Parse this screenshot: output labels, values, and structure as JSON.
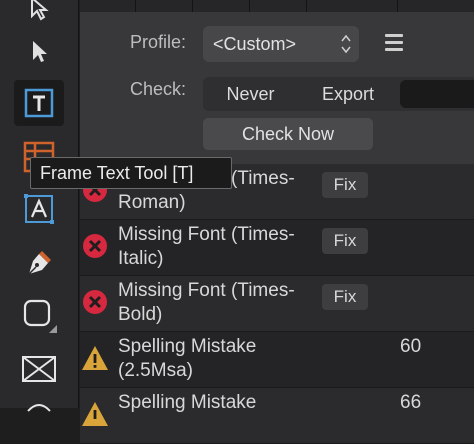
{
  "toolbar": {
    "tools": [
      {
        "name": "pointer-tool",
        "icon": "arrow-cursor-icon"
      },
      {
        "name": "move-tool",
        "icon": "move-arrow-icon"
      },
      {
        "name": "artistic-text-tool",
        "icon": "text-box-icon",
        "active": true
      },
      {
        "name": "table-tool",
        "icon": "table-icon"
      },
      {
        "name": "frame-text-tool",
        "icon": "frame-text-icon"
      },
      {
        "name": "pen-tool",
        "icon": "pen-nib-icon"
      },
      {
        "name": "shape-tool",
        "icon": "rounded-square-icon"
      },
      {
        "name": "picture-frame-tool",
        "icon": "picture-frame-icon"
      }
    ]
  },
  "tooltip": {
    "text": "Frame Text Tool [T]"
  },
  "preflight": {
    "profile_label": "Profile:",
    "profile_value": "<Custom>",
    "check_label": "Check:",
    "check_options": [
      "Never",
      "Export"
    ],
    "check_now_label": "Check Now"
  },
  "issues": [
    {
      "type": "error",
      "line1": "Missing Font (Times-",
      "line2": "Roman)",
      "action": "Fix",
      "count": ""
    },
    {
      "type": "error",
      "line1": "Missing Font (Times-",
      "line2": "Italic)",
      "action": "Fix",
      "count": ""
    },
    {
      "type": "error",
      "line1": "Missing Font (Times-",
      "line2": "Bold)",
      "action": "Fix",
      "count": ""
    },
    {
      "type": "warning",
      "line1": "Spelling Mistake",
      "line2": "(2.5Msa)",
      "action": "",
      "count": "60"
    },
    {
      "type": "warning",
      "line1": "Spelling Mistake",
      "line2": "",
      "action": "",
      "count": "66"
    }
  ],
  "colors": {
    "error": "#d6293f",
    "warning": "#d9a53a",
    "accent_orange": "#d0632b",
    "accent_blue": "#4d9ad8"
  }
}
